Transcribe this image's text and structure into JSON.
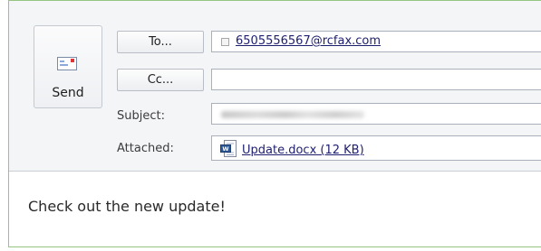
{
  "send": {
    "label": "Send",
    "icon": "send-envelope-icon"
  },
  "to": {
    "button_label": "To...",
    "recipient": "6505556567@rcfax.com"
  },
  "cc": {
    "button_label": "Cc...",
    "value": ""
  },
  "subject": {
    "label": "Subject:",
    "value_blurred": true
  },
  "attached": {
    "label": "Attached:",
    "file": "Update.docx (12 KB)",
    "icon": "word-document-icon"
  },
  "body": {
    "text": "Check out the new update!"
  },
  "colors": {
    "window_border": "#96c483",
    "header_background": "#f4f5f7",
    "link": "#1e1e6e"
  }
}
